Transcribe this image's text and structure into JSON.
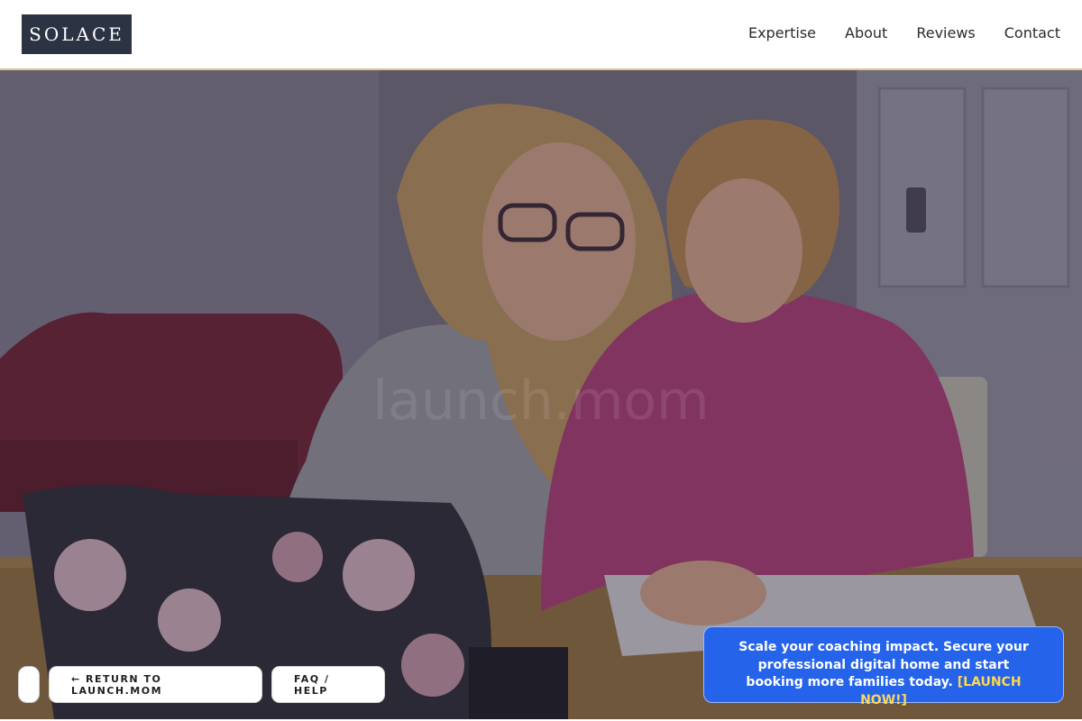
{
  "header": {
    "logo": "SOLACE",
    "nav": [
      "Expertise",
      "About",
      "Reviews",
      "Contact"
    ]
  },
  "hero": {
    "watermark": "launch.mom",
    "image_description_icon": "photo-icon"
  },
  "buttons": {
    "return_label": "← RETURN TO LAUNCH.MOM",
    "faq_label": "FAQ / HELP"
  },
  "promo": {
    "text": "Scale your coaching impact. Secure your professional digital home and start booking more families today.",
    "cta": "[LAUNCH NOW!]"
  },
  "colors": {
    "logo_bg": "#2c3444",
    "accent_border": "#d9c48a",
    "promo_bg": "#2563eb",
    "promo_cta": "#ffd84d"
  }
}
